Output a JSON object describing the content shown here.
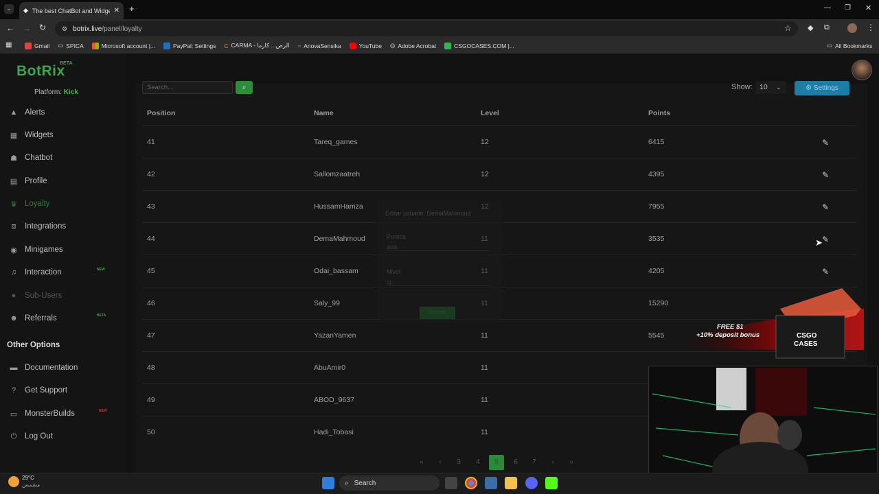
{
  "browser": {
    "tab_title": "The best ChatBot and Widgets",
    "url_host": "botrix.live",
    "url_path": "/panel/loyalty",
    "bookmarks": [
      "Gmail",
      "SPICA",
      "Microsoft account |...",
      "PayPal: Settings",
      "CARMA - الرص... كارما",
      "AnovaSensika",
      "YouTube",
      "Adobe Acrobat",
      "CSGOCASES.COM |..."
    ],
    "all_bookmarks": "All Bookmarks"
  },
  "sidebar": {
    "logo": "BotRix",
    "logo_badge": "BETA",
    "platform_label": "Platform:",
    "platform_value": "Kick",
    "items": [
      {
        "label": "Alerts",
        "icon": "warning-icon"
      },
      {
        "label": "Widgets",
        "icon": "grid-icon"
      },
      {
        "label": "Chatbot",
        "icon": "robot-icon"
      },
      {
        "label": "Profile",
        "icon": "id-card-icon"
      },
      {
        "label": "Loyalty",
        "icon": "trophy-icon"
      },
      {
        "label": "Integrations",
        "icon": "plug-icon"
      },
      {
        "label": "Minigames",
        "icon": "gamepad-icon"
      },
      {
        "label": "Interaction",
        "icon": "music-icon",
        "tag": "NEW"
      },
      {
        "label": "Sub-Users",
        "icon": "users-icon"
      },
      {
        "label": "Referrals",
        "icon": "people-icon",
        "tag": "BETA"
      }
    ],
    "other_title": "Other Options",
    "other_items": [
      {
        "label": "Documentation",
        "icon": "book-icon"
      },
      {
        "label": "Get Support",
        "icon": "question-icon"
      },
      {
        "label": "MonsterBuilds",
        "icon": "monitor-icon",
        "tag": "NEW"
      },
      {
        "label": "Log Out",
        "icon": "logout-icon"
      }
    ]
  },
  "toolbar": {
    "search_placeholder": "Search...",
    "show_label": "Show:",
    "show_value": "10",
    "settings_label": "Settings"
  },
  "table": {
    "headers": [
      "Position",
      "Name",
      "Level",
      "Points"
    ],
    "rows": [
      {
        "position": "41",
        "name": "Tareq_games",
        "level": "12",
        "points": "6415"
      },
      {
        "position": "42",
        "name": "Sallomzaatreh",
        "level": "12",
        "points": "4395"
      },
      {
        "position": "43",
        "name": "HussamHamza",
        "level": "12",
        "points": "7955"
      },
      {
        "position": "44",
        "name": "DemaMahmoud",
        "level": "11",
        "points": "3535"
      },
      {
        "position": "45",
        "name": "Odai_bassam",
        "level": "11",
        "points": "4205"
      },
      {
        "position": "46",
        "name": "Saly_99",
        "level": "11",
        "points": "15290"
      },
      {
        "position": "47",
        "name": "YazanYamen",
        "level": "11",
        "points": "5545"
      },
      {
        "position": "48",
        "name": "AbuAmir0",
        "level": "11",
        "points": ""
      },
      {
        "position": "49",
        "name": "ABOD_9637",
        "level": "11",
        "points": ""
      },
      {
        "position": "50",
        "name": "Hadi_Tobasi",
        "level": "11",
        "points": ""
      }
    ]
  },
  "modal": {
    "title": "Editar usuario: DemaMahmoud",
    "points_label": "Puntos",
    "points_value": "3535",
    "level_label": "Nivel",
    "level_value": "11",
    "save_label": "Guardar"
  },
  "pagination": {
    "pages": [
      "3",
      "4",
      "5",
      "6",
      "7"
    ],
    "current": "5"
  },
  "ad": {
    "line1": "FREE $1",
    "line2": "+10% deposit bonus",
    "brand_top": "CSGO",
    "brand_bottom": "CASES"
  },
  "taskbar": {
    "temperature": "29°C",
    "weather": "مشمس",
    "search_label": "Search"
  },
  "colors": {
    "accent_green": "#2f9a41",
    "settings_blue": "#1d7ea5",
    "page_bg": "#121212"
  }
}
